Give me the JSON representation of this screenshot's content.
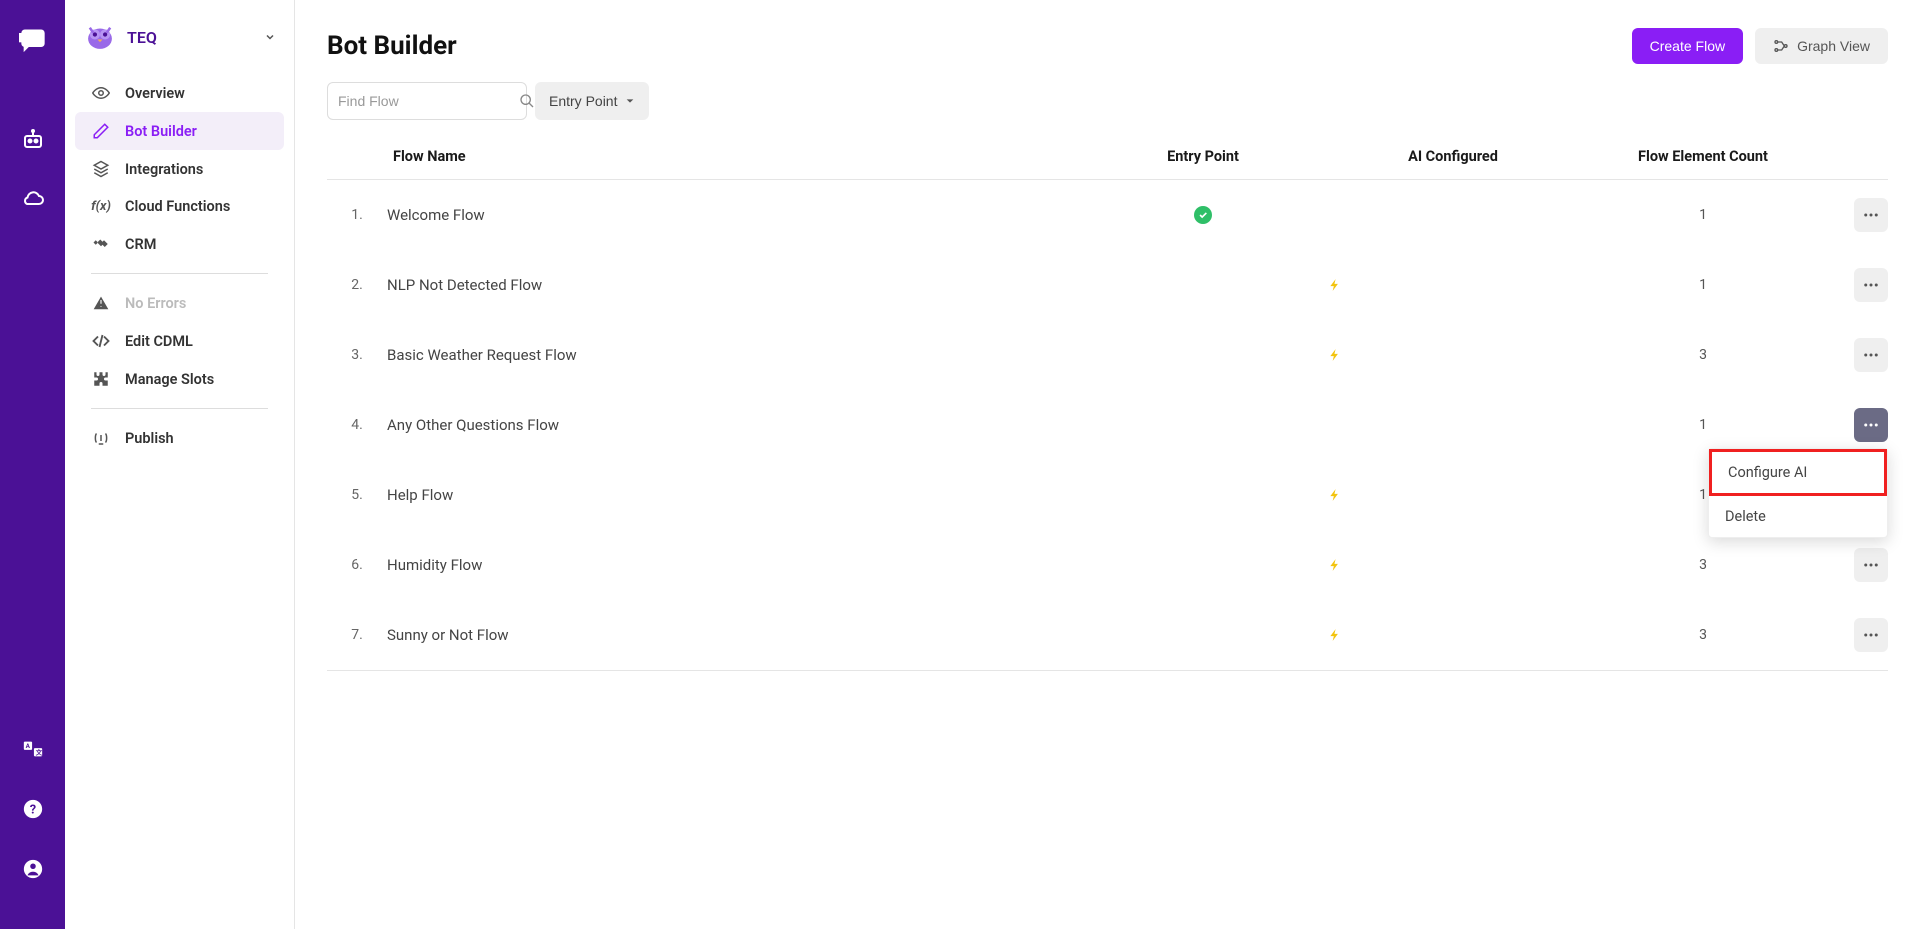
{
  "org": {
    "name": "TEQ"
  },
  "rail_icons": [
    "chat-icon",
    "bot-icon",
    "cloud-icon"
  ],
  "rail_bottom_icons": [
    "translate-icon",
    "help-icon",
    "account-icon"
  ],
  "sidebar": {
    "items": [
      {
        "label": "Overview",
        "icon": "eye-icon"
      },
      {
        "label": "Bot Builder",
        "icon": "pencil-icon",
        "active": true
      },
      {
        "label": "Integrations",
        "icon": "layers-icon"
      },
      {
        "label": "Cloud Functions",
        "icon": "function-icon"
      },
      {
        "label": "CRM",
        "icon": "handshake-icon"
      }
    ],
    "status": {
      "label": "No Errors",
      "icon": "warning-icon"
    },
    "items2": [
      {
        "label": "Edit CDML",
        "icon": "code-icon"
      },
      {
        "label": "Manage Slots",
        "icon": "puzzle-icon"
      }
    ],
    "items3": [
      {
        "label": "Publish",
        "icon": "broadcast-icon"
      }
    ]
  },
  "header": {
    "title": "Bot Builder",
    "create_flow_label": "Create Flow",
    "graph_view_label": "Graph View"
  },
  "toolbar": {
    "search_placeholder": "Find Flow",
    "filter_label": "Entry Point"
  },
  "table": {
    "columns": {
      "name": "Flow Name",
      "entry": "Entry Point",
      "ai": "AI Configured",
      "count": "Flow Element Count"
    },
    "rows": [
      {
        "idx": "1.",
        "name": "Welcome Flow",
        "entry": true,
        "ai": false,
        "count": "1"
      },
      {
        "idx": "2.",
        "name": "NLP Not Detected Flow",
        "entry": false,
        "ai": true,
        "count": "1"
      },
      {
        "idx": "3.",
        "name": "Basic Weather Request Flow",
        "entry": false,
        "ai": true,
        "count": "3"
      },
      {
        "idx": "4.",
        "name": "Any Other Questions Flow",
        "entry": false,
        "ai": false,
        "count": "1",
        "menu_open": true
      },
      {
        "idx": "5.",
        "name": "Help Flow",
        "entry": false,
        "ai": true,
        "count": "1"
      },
      {
        "idx": "6.",
        "name": "Humidity Flow",
        "entry": false,
        "ai": true,
        "count": "3"
      },
      {
        "idx": "7.",
        "name": "Sunny or Not Flow",
        "entry": false,
        "ai": true,
        "count": "3"
      }
    ]
  },
  "dropdown": {
    "configure_ai": "Configure AI",
    "delete": "Delete"
  }
}
